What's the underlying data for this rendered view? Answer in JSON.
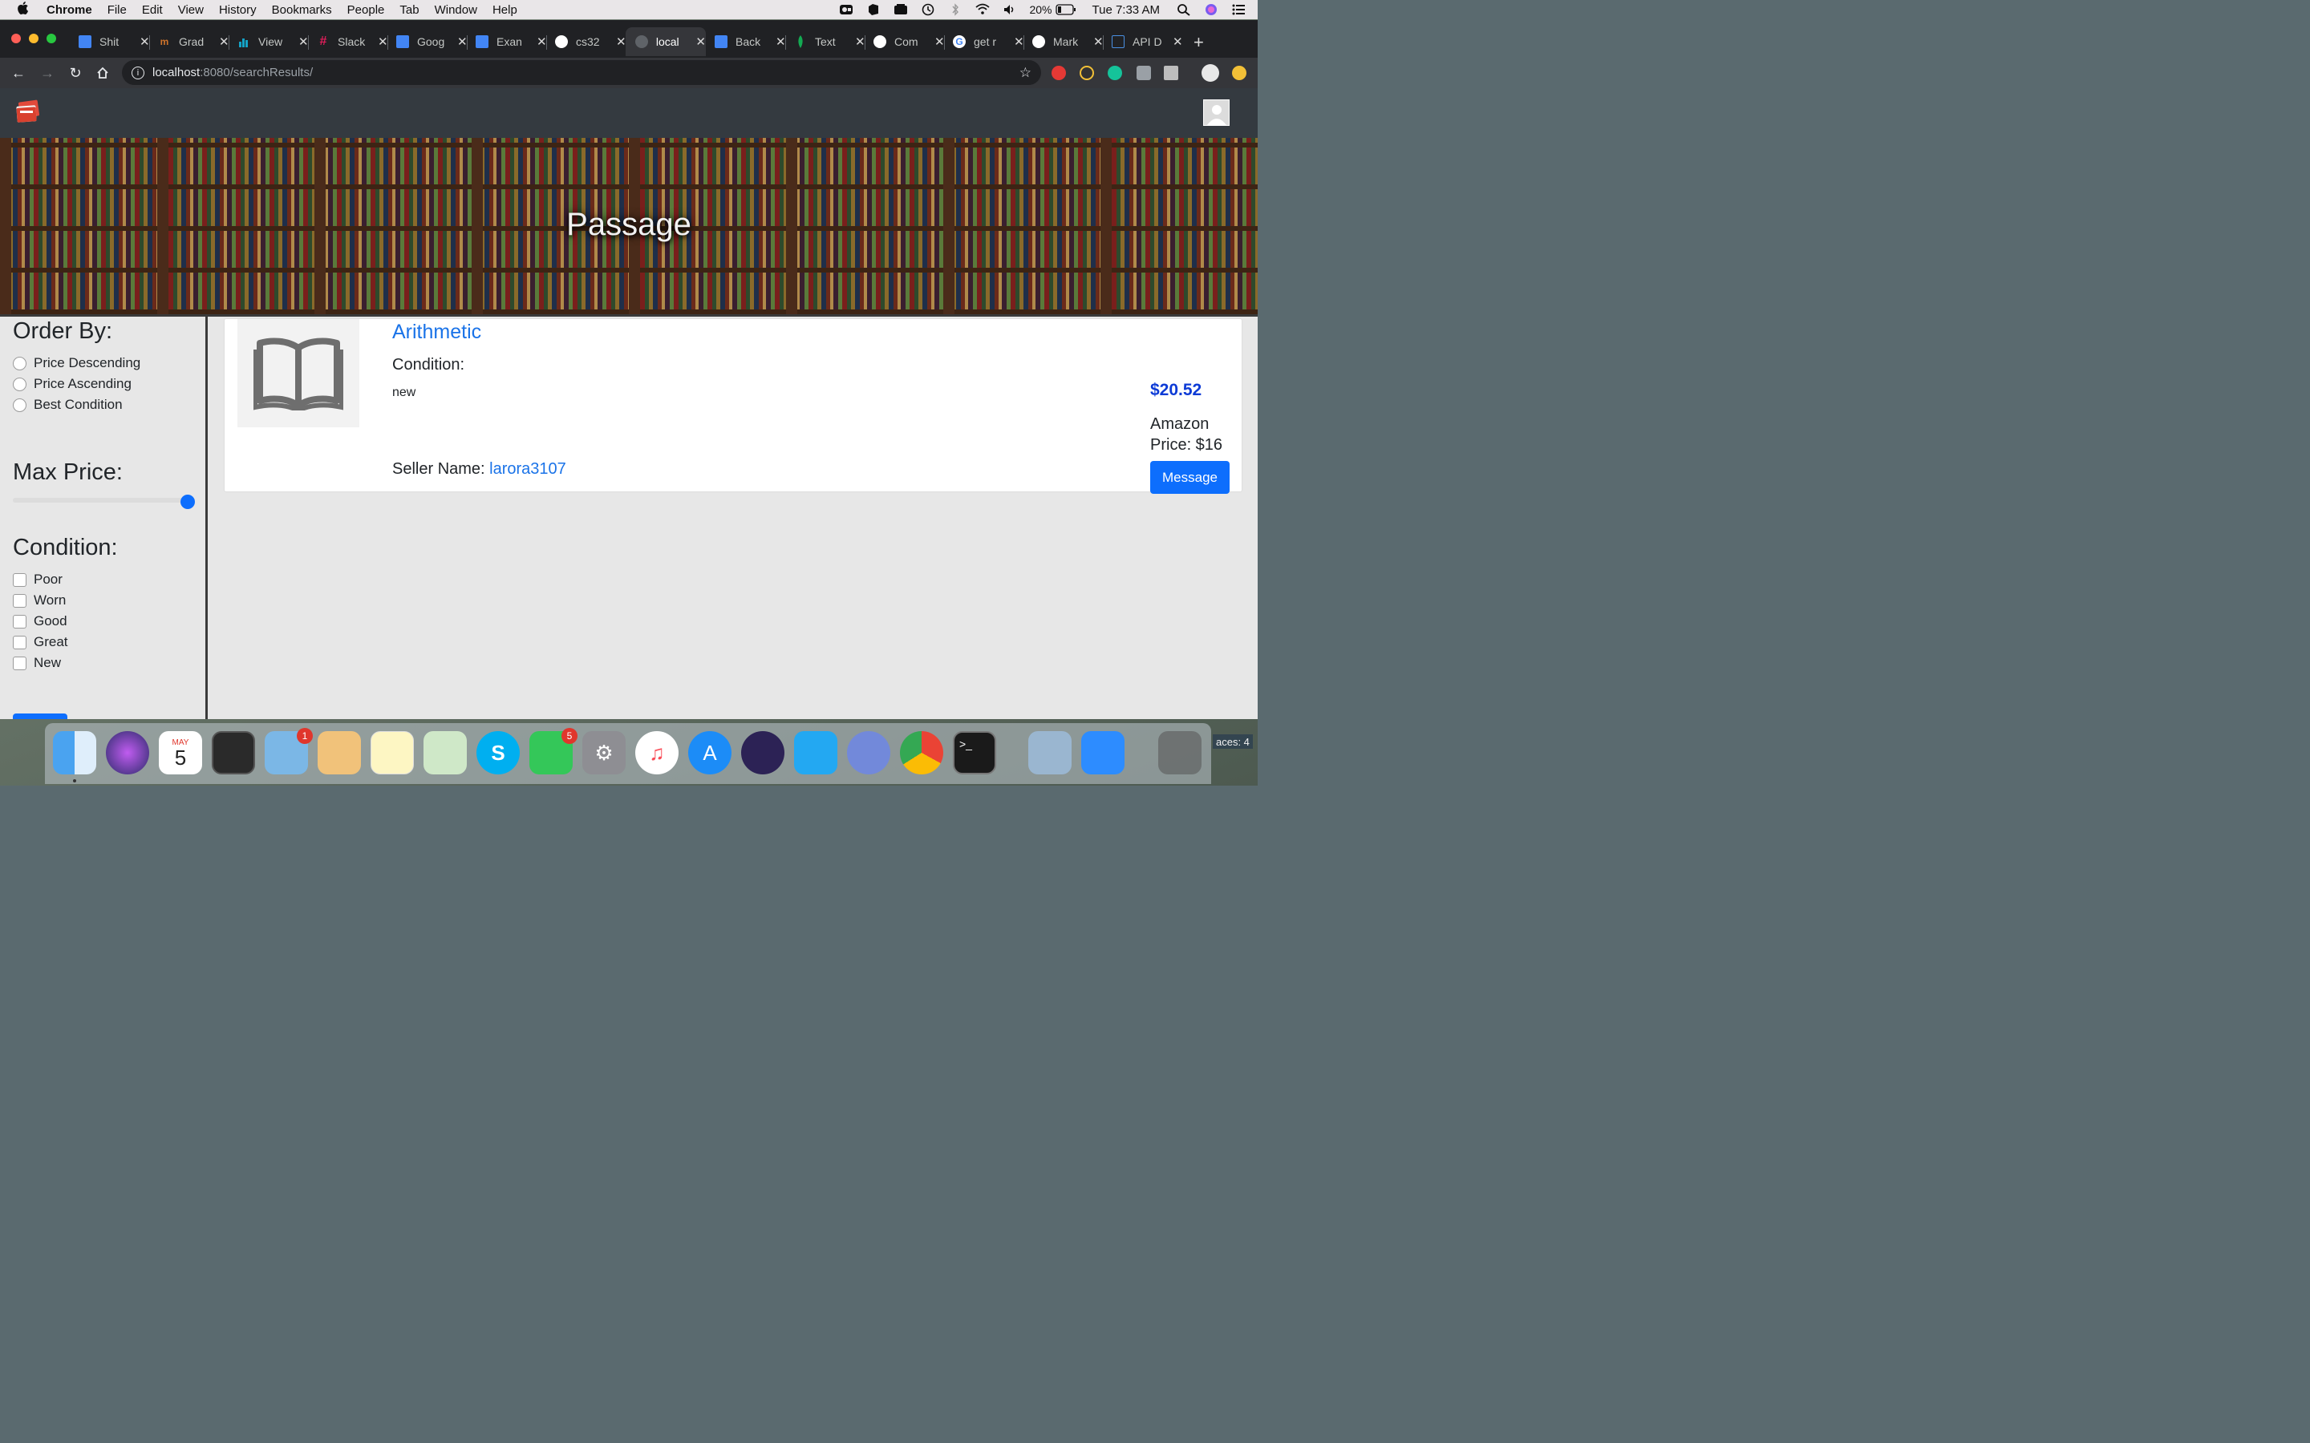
{
  "menubar": {
    "app": "Chrome",
    "items": [
      "File",
      "Edit",
      "View",
      "History",
      "Bookmarks",
      "People",
      "Tab",
      "Window",
      "Help"
    ],
    "battery": "20%",
    "clock": "Tue 7:33 AM"
  },
  "browser": {
    "tabs": [
      {
        "label": "Shit",
        "icon": "google-docs-icon"
      },
      {
        "label": "Grad",
        "icon": "gradescope-icon"
      },
      {
        "label": "View",
        "icon": "chart-icon"
      },
      {
        "label": "Slack",
        "icon": "slack-icon"
      },
      {
        "label": "Goog",
        "icon": "google-docs-icon"
      },
      {
        "label": "Exan",
        "icon": "google-docs-icon"
      },
      {
        "label": "cs32",
        "icon": "github-icon"
      },
      {
        "label": "local",
        "icon": "globe-icon",
        "active": true
      },
      {
        "label": "Back",
        "icon": "google-docs-icon"
      },
      {
        "label": "Text",
        "icon": "mongodb-icon"
      },
      {
        "label": "Com",
        "icon": "github-icon"
      },
      {
        "label": "get r",
        "icon": "google-icon"
      },
      {
        "label": "Mark",
        "icon": "github-icon"
      },
      {
        "label": "API D",
        "icon": "robot-icon"
      }
    ],
    "url_host": "localhost",
    "url_rest": ":8080/searchResults/"
  },
  "page": {
    "hero_title": "Passage",
    "sidebar": {
      "order_by_heading": "Order By:",
      "order_options": [
        "Price Descending",
        "Price Ascending",
        "Best Condition"
      ],
      "max_price_heading": "Max Price:",
      "max_price_slider_fraction": 1.0,
      "condition_heading": "Condition:",
      "condition_options": [
        "Poor",
        "Worn",
        "Good",
        "Great",
        "New"
      ]
    },
    "listing": {
      "title": "Arithmetic",
      "condition_label": "Condition:",
      "condition_value": "new",
      "seller_label": "Seller Name:",
      "seller_name": "larora3107",
      "price": "$20.52",
      "amazon_price": "Amazon Price: $16",
      "message_button": "Message"
    }
  },
  "dock": {
    "mail_badge": "1",
    "facetime_badge": "5",
    "calendar_month": "MAY",
    "calendar_day": "5",
    "spaces": "aces: 4"
  },
  "colors": {
    "accent": "#0d6efd",
    "link": "#1a73e8",
    "navbar": "#343a40",
    "price": "#0d3bd6"
  }
}
